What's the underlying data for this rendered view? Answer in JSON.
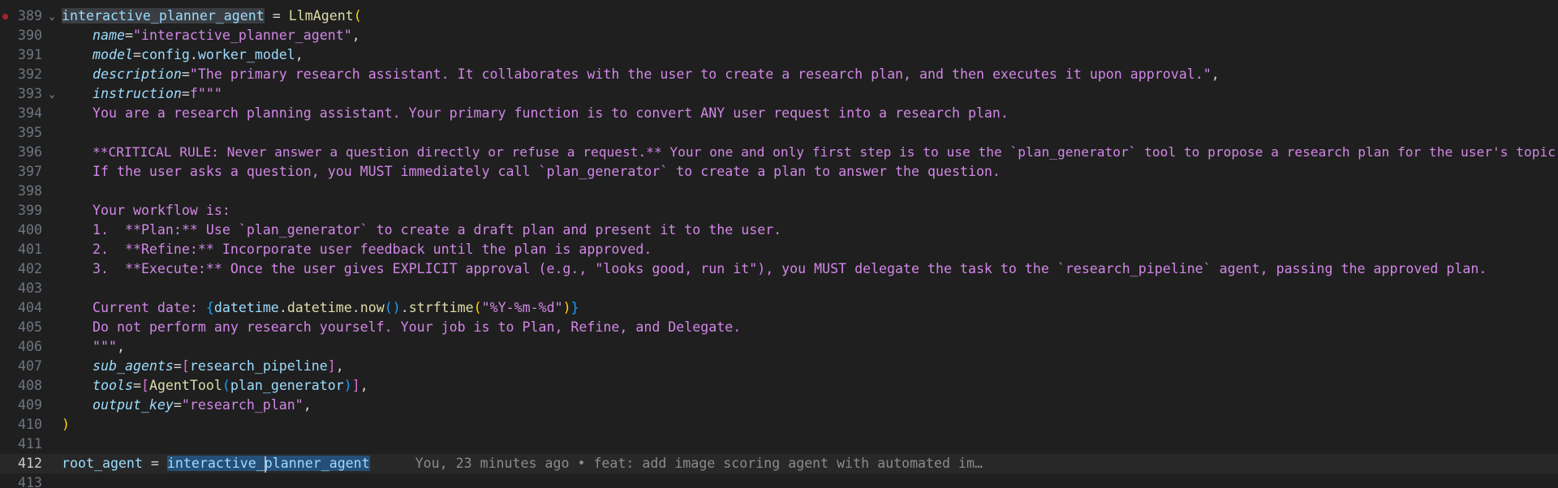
{
  "editor": {
    "lines": [
      {
        "num": "389",
        "breakpoint": true,
        "fold": "⌄"
      },
      {
        "num": "390"
      },
      {
        "num": "391"
      },
      {
        "num": "392"
      },
      {
        "num": "393",
        "fold": "⌄"
      },
      {
        "num": "394"
      },
      {
        "num": "395"
      },
      {
        "num": "396"
      },
      {
        "num": "397"
      },
      {
        "num": "398"
      },
      {
        "num": "399"
      },
      {
        "num": "400"
      },
      {
        "num": "401"
      },
      {
        "num": "402"
      },
      {
        "num": "403"
      },
      {
        "num": "404"
      },
      {
        "num": "405"
      },
      {
        "num": "406"
      },
      {
        "num": "407"
      },
      {
        "num": "408"
      },
      {
        "num": "409"
      },
      {
        "num": "410"
      },
      {
        "num": "411"
      },
      {
        "num": "412",
        "current": true
      },
      {
        "num": "413"
      }
    ],
    "code": {
      "l389": {
        "var": "interactive_planner_agent",
        "eq": " = ",
        "cls": "LlmAgent",
        "open": "("
      },
      "l390": {
        "param": "name",
        "eq": "=",
        "str": "\"interactive_planner_agent\"",
        "tail": ","
      },
      "l391": {
        "param": "model",
        "eq": "=",
        "obj": "config",
        "dot": ".",
        "attr": "worker_model",
        "tail": ","
      },
      "l392": {
        "param": "description",
        "eq": "=",
        "str": "\"The primary research assistant. It collaborates with the user to create a research plan, and then executes it upon approval.\"",
        "tail": ","
      },
      "l393": {
        "param": "instruction",
        "eq": "=",
        "str": "f\"\"\""
      },
      "l394": "You are a research planning assistant. Your primary function is to convert ANY user request into a research plan.",
      "l396": "**CRITICAL RULE: Never answer a question directly or refuse a request.** Your one and only first step is to use the `plan_generator` tool to propose a research plan for the user's topic.",
      "l397": "If the user asks a question, you MUST immediately call `plan_generator` to create a plan to answer the question.",
      "l399": "Your workflow is:",
      "l400": "1.  **Plan:** Use `plan_generator` to create a draft plan and present it to the user.",
      "l401": "2.  **Refine:** Incorporate user feedback until the plan is approved.",
      "l402": "3.  **Execute:** Once the user gives EXPLICIT approval (e.g., \"looks good, run it\"), you MUST delegate the task to the `research_pipeline` agent, passing the approved plan.",
      "l404": {
        "prefix": "Current date: ",
        "brace_open": "{",
        "mod": "datetime",
        "dot1": ".",
        "cls": "datetime",
        "dot2": ".",
        "fn1": "now",
        "call": "()",
        "dot3": ".",
        "fn2": "strftime",
        "p_open": "(",
        "fmt": "\"%Y-%m-%d\"",
        "p_close": ")",
        "brace_close": "}"
      },
      "l405": "Do not perform any research yourself. Your job is to Plan, Refine, and Delegate.",
      "l406": {
        "str": "\"\"\"",
        "tail": ","
      },
      "l407": {
        "param": "sub_agents",
        "eq": "=",
        "b_open": "[",
        "val": "research_pipeline",
        "b_close": "]",
        "tail": ","
      },
      "l408": {
        "param": "tools",
        "eq": "=",
        "b_open": "[",
        "cls": "AgentTool",
        "p_open": "(",
        "val": "plan_generator",
        "p_close": ")",
        "b_close": "]",
        "tail": ","
      },
      "l409": {
        "param": "output_key",
        "eq": "=",
        "str": "\"research_plan\"",
        "tail": ","
      },
      "l410": ")",
      "l412": {
        "var": "root_agent",
        "eq": " = ",
        "ref_a": "interactive_",
        "ref_b": "planner_agent"
      }
    },
    "blame": "You, 23 minutes ago • feat: add image scoring agent with automated im…"
  },
  "colors": {
    "background": "#1f1f1f",
    "string": "#d187e6",
    "variable": "#9cdcfe",
    "function": "#dcdcaa",
    "bracket_gold": "#ffd700",
    "bracket_orchid": "#da70d6",
    "bracket_blue": "#179fff",
    "line_number": "#6e7681",
    "breakpoint": "#a3262a"
  }
}
